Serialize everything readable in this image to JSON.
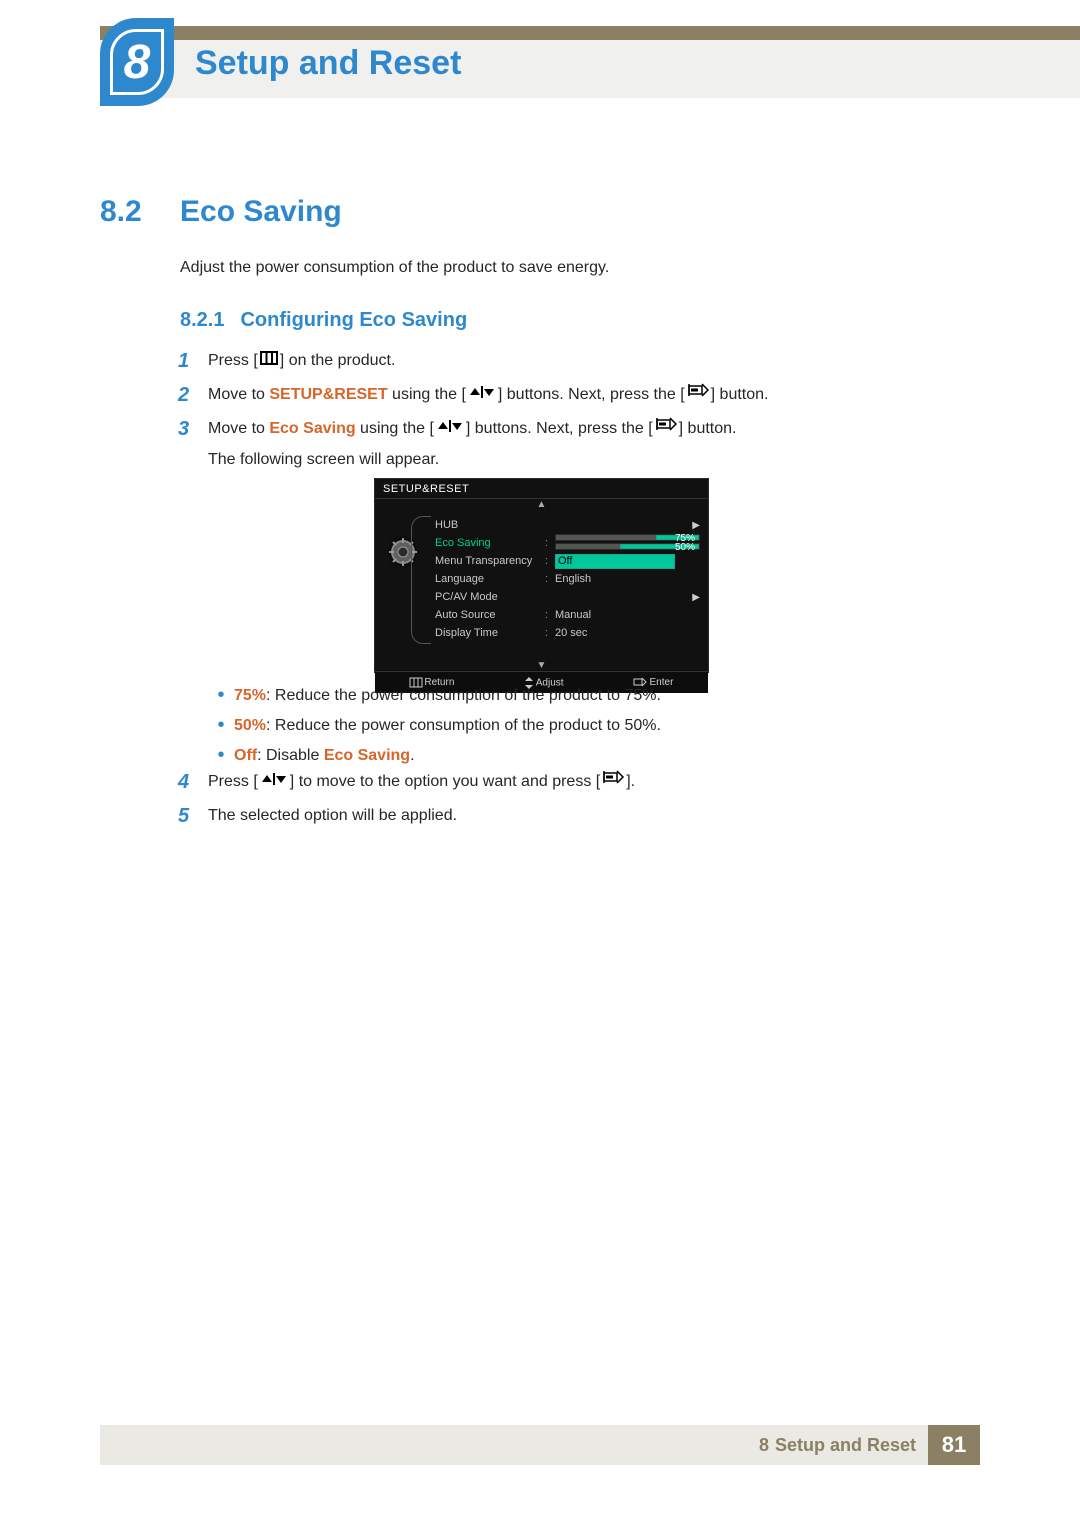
{
  "chapter": {
    "number": "8",
    "title": "Setup and Reset"
  },
  "section": {
    "number": "8.2",
    "title": "Eco Saving",
    "intro": "Adjust the power consumption of the product to save energy."
  },
  "subsection": {
    "number": "8.2.1",
    "title": "Configuring Eco Saving"
  },
  "steps": {
    "s1": {
      "n": "1",
      "a": "Press [",
      "b": "] on the product."
    },
    "s2": {
      "n": "2",
      "a": "Move to ",
      "menu": "SETUP&RESET",
      "b": " using the [",
      "c": "] buttons. Next, press the [",
      "d": "] button."
    },
    "s3": {
      "n": "3",
      "a": "Move to ",
      "menu": "Eco Saving",
      "b": " using the [",
      "c": "] buttons. Next, press the [",
      "d": "] button.",
      "tail": "The following screen will appear."
    },
    "s4": {
      "n": "4",
      "a": "Press [",
      "b": "] to move to the option you want and press [",
      "c": "]."
    },
    "s5": {
      "n": "5",
      "a": "The selected option will be applied."
    }
  },
  "osd": {
    "title": "SETUP&RESET",
    "rows": {
      "hub": "HUB",
      "eco": "Eco Saving",
      "menu_transparency": {
        "label": "Menu Transparency",
        "value": "Off"
      },
      "language": {
        "label": "Language",
        "value": "English"
      },
      "pcav": "PC/AV Mode",
      "auto_source": {
        "label": "Auto Source",
        "value": "Manual"
      },
      "display_time": {
        "label": "Display Time",
        "value": "20 sec"
      }
    },
    "bars": {
      "b75": "75%",
      "b50": "50%"
    },
    "footer": {
      "return": "Return",
      "adjust": "Adjust",
      "enter": "Enter"
    }
  },
  "bullets": {
    "b1": {
      "label": "75%",
      "text": ": Reduce the power consumption of the product to 75%."
    },
    "b2": {
      "label": "50%",
      "text": ": Reduce the power consumption of the product to 50%."
    },
    "b3": {
      "label": "Off",
      "mid": ": Disable ",
      "eco": "Eco Saving",
      "end": "."
    }
  },
  "footer": {
    "chapter_n": "8",
    "chapter_t": "Setup and Reset",
    "page": "81"
  }
}
